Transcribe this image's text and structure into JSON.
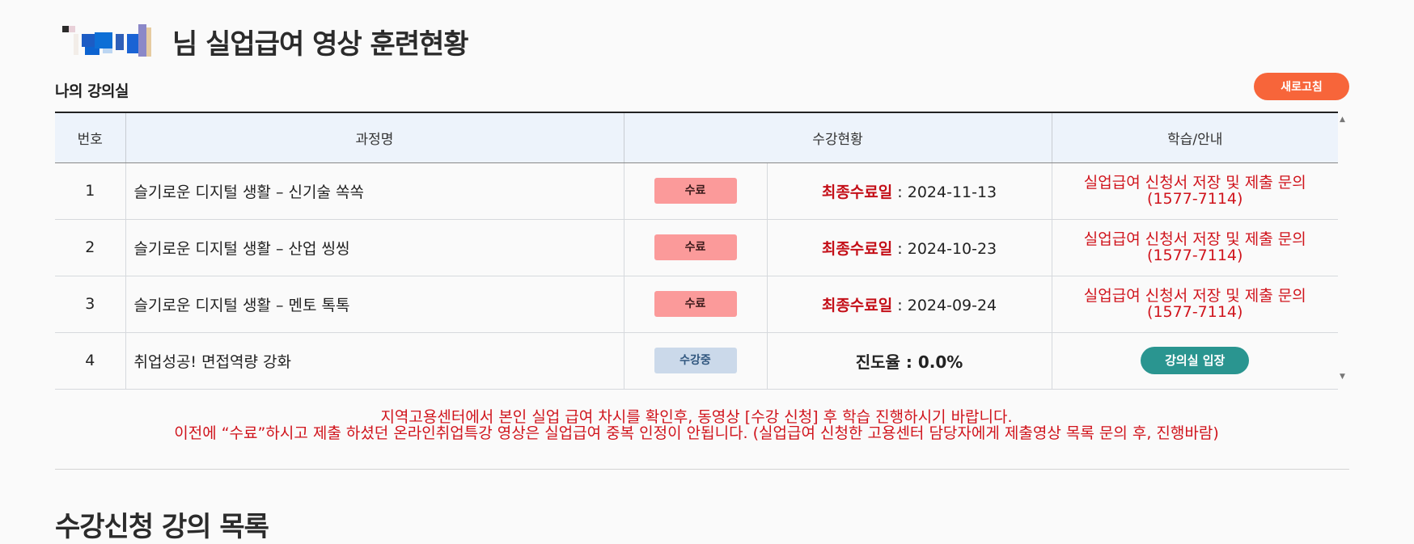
{
  "header": {
    "title_suffix": "님 실업급여 영상 훈련현황"
  },
  "classroom": {
    "section_title": "나의 강의실",
    "refresh_label": "새로고침",
    "columns": [
      "번호",
      "과정명",
      "수강현황",
      "학습/안내"
    ],
    "rows": [
      {
        "no": "1",
        "course": "슬기로운 디지털 생활 – 신기술 쏙쏙",
        "status": "수료",
        "detail_label": "최종수료일",
        "detail_value": " : 2024-11-13",
        "help_line1": "실업급여 신청서 저장 및 제출 문의",
        "help_line2": "(1577-7114)"
      },
      {
        "no": "2",
        "course": "슬기로운 디지털 생활 – 산업 씽씽",
        "status": "수료",
        "detail_label": "최종수료일",
        "detail_value": " : 2024-10-23",
        "help_line1": "실업급여 신청서 저장 및 제출 문의",
        "help_line2": "(1577-7114)"
      },
      {
        "no": "3",
        "course": "슬기로운 디지털 생활 – 멘토 톡톡",
        "status": "수료",
        "detail_label": "최종수료일",
        "detail_value": " : 2024-09-24",
        "help_line1": "실업급여 신청서 저장 및 제출 문의",
        "help_line2": "(1577-7114)"
      },
      {
        "no": "4",
        "course": "취업성공! 면접역량 강화",
        "status": "수강중",
        "progress_text": "진도율 : 0.0%",
        "action_label": "강의실 입장"
      }
    ]
  },
  "notice": {
    "line1": "지역고용센터에서 본인 실업 급여 차시를 확인후, 동영상 [수강 신청] 후 학습 진행하시기 바랍니다.",
    "line2": "이전에 “수료”하시고 제출 하셨던 온라인취업특강 영상은 실업급여 중복 인정이 안됩니다. (실업급여 신청한 고용센터 담당자에게 제출영상 목록 문의 후, 진행바람)"
  },
  "next_section": {
    "title": "수강신청 강의 목록"
  },
  "colors": {
    "accent_orange": "#f7653a",
    "alert_red": "#d0141c",
    "badge_done": "#fb9a9a",
    "badge_progress": "#cbd9ea",
    "teal_button": "#2a9590",
    "header_bg": "#edf3fb"
  }
}
